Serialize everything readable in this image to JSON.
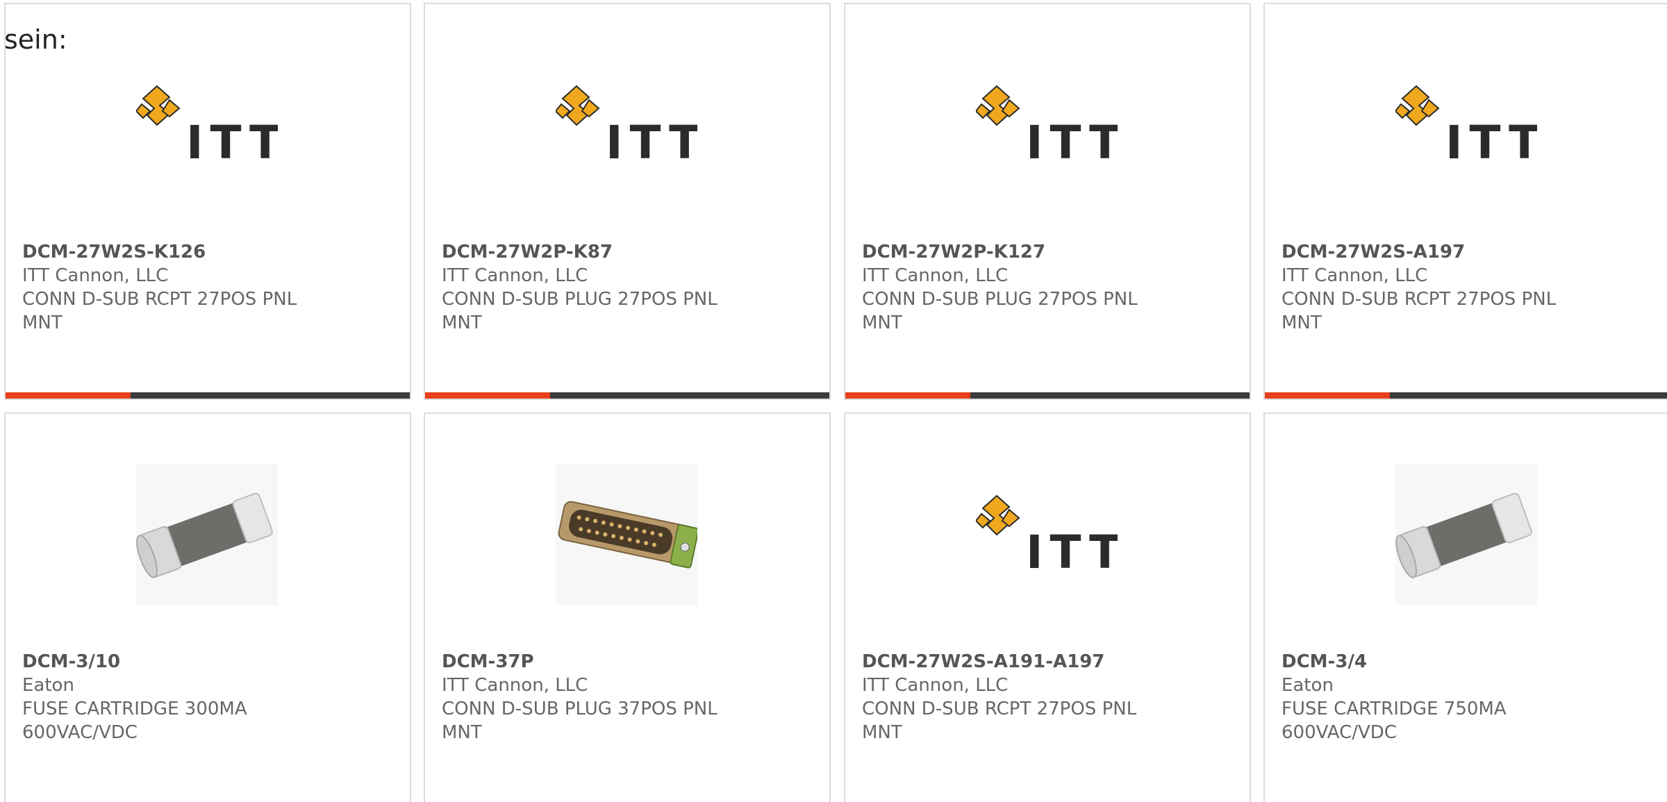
{
  "page_fragment": "sein:",
  "brand_colors": {
    "accent": "#e8401c",
    "bar_track": "#3b3b3b",
    "itt_gold": "#f0a81e",
    "itt_text": "#2b2b2b"
  },
  "products": [
    {
      "part_number": "DCM-27W2S-K126",
      "manufacturer": "ITT Cannon, LLC",
      "description": "CONN D-SUB RCPT 27POS PNL MNT",
      "image": "itt-logo-icon",
      "logo_text": "ITT",
      "progress": 0.31
    },
    {
      "part_number": "DCM-27W2P-K87",
      "manufacturer": "ITT Cannon, LLC",
      "description": "CONN D-SUB PLUG 27POS PNL MNT",
      "image": "itt-logo-icon",
      "logo_text": "ITT",
      "progress": 0.31
    },
    {
      "part_number": "DCM-27W2P-K127",
      "manufacturer": "ITT Cannon, LLC",
      "description": "CONN D-SUB PLUG 27POS PNL MNT",
      "image": "itt-logo-icon",
      "logo_text": "ITT",
      "progress": 0.31
    },
    {
      "part_number": "DCM-27W2S-A197",
      "manufacturer": "ITT Cannon, LLC",
      "description": "CONN D-SUB RCPT 27POS PNL MNT",
      "image": "itt-logo-icon",
      "logo_text": "ITT",
      "progress": 0.31
    },
    {
      "part_number": "DCM-3/10",
      "manufacturer": "Eaton",
      "description": "FUSE CARTRIDGE 300MA 600VAC/VDC",
      "image": "fuse-cartridge-icon"
    },
    {
      "part_number": "DCM-37P",
      "manufacturer": "ITT Cannon, LLC",
      "description": "CONN D-SUB PLUG 37POS PNL MNT",
      "image": "dsub-connector-icon"
    },
    {
      "part_number": "DCM-27W2S-A191-A197",
      "manufacturer": "ITT Cannon, LLC",
      "description": "CONN D-SUB RCPT 27POS PNL MNT",
      "image": "itt-logo-icon",
      "logo_text": "ITT"
    },
    {
      "part_number": "DCM-3/4",
      "manufacturer": "Eaton",
      "description": "FUSE CARTRIDGE 750MA 600VAC/VDC",
      "image": "fuse-cartridge-icon"
    }
  ]
}
